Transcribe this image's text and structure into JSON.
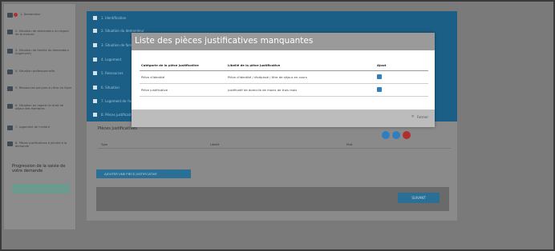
{
  "sidebar": {
    "items": [
      {
        "label": "1. Demandeur",
        "icon": "person-icon"
      },
      {
        "label": "2. Situation de demandeur au regard de la mesure",
        "icon": "family-icon"
      },
      {
        "label": "3. Situation de famille du demandeur (logement)",
        "icon": "house-icon"
      },
      {
        "label": "4. Situation professionnelle",
        "icon": "briefcase-icon"
      },
      {
        "label": "5. Ressources perçues au titre du foyer",
        "icon": "euro-icon"
      },
      {
        "label": "6. Situation au regard du droit de séjour des membres",
        "icon": "id-card-icon"
      },
      {
        "label": "7. Logement de l'enfant",
        "icon": "home-icon"
      },
      {
        "label": "8. Pièces justificatives à joindre à la demande",
        "icon": "document-icon"
      }
    ],
    "progress_title": "Progression de la saisie de votre demande"
  },
  "main": {
    "steps": [
      "1. Identification",
      "2. Situation du demandeur",
      "3. Situation de famille",
      "4. Logement",
      "5. Ressources",
      "6. Situation",
      "7. Logement de l'enfant",
      "8. Pièces justificatives"
    ],
    "pieces_title": "Pièces justificatives",
    "columns": [
      "Type",
      "Libellé",
      "Etat"
    ],
    "add_button": "AJOUTER UNE PIÈCE JUSTIFICATIVE",
    "next_button": "SUIVANT"
  },
  "modal": {
    "title": "Liste des pièces justificatives manquantes",
    "headers": [
      "Catégorie de la pièce justificative",
      "Libellé de la pièce justificative",
      "Ajout"
    ],
    "rows": [
      {
        "category": "Pièce d'identité",
        "label": "Pièce d'identité / récépissé / titre de séjour en cours"
      },
      {
        "category": "Pièce justificative",
        "label": "Justificatif de domicile de moins de trois mois"
      }
    ],
    "close_label": "Fermer"
  },
  "colors": {
    "accent": "#1c5f86",
    "checkbox": "#2f7fc0",
    "danger": "#b02f2f"
  }
}
